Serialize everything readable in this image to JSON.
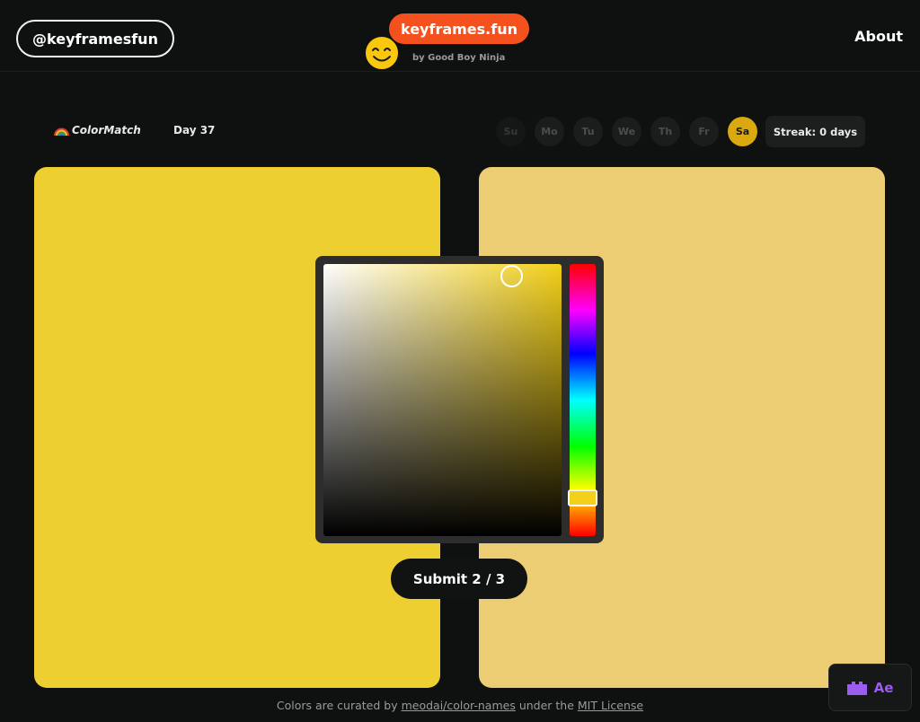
{
  "header": {
    "handle": "@keyframesfun",
    "logo": "keyframes.fun",
    "byline": "by Good Boy Ninja",
    "about": "About"
  },
  "toolbar": {
    "brand": "ColorMatch",
    "brand_icon": "rainbow-icon",
    "day": "Day 37",
    "weekdays": [
      {
        "label": "Su",
        "state": "dim"
      },
      {
        "label": "Mo",
        "state": "inactive"
      },
      {
        "label": "Tu",
        "state": "inactive"
      },
      {
        "label": "We",
        "state": "inactive"
      },
      {
        "label": "Th",
        "state": "inactive"
      },
      {
        "label": "Fr",
        "state": "inactive"
      },
      {
        "label": "Sa",
        "state": "active"
      }
    ],
    "streak": "Streak: 0 days"
  },
  "panels": {
    "target_color": "#eecf31",
    "guess_color": "#eccd73"
  },
  "picker": {
    "hue_color": "#f3d019"
  },
  "submit": {
    "label": "Submit 2 / 3"
  },
  "footer": {
    "prefix": "Colors are curated by ",
    "link1": "meodai/color-names",
    "middle": " under the ",
    "link2": "MIT License"
  },
  "badge": {
    "label": "Ae",
    "icon": "plugin-icon"
  },
  "colors": {
    "accent_orange": "#f4511e",
    "active_day": "#d9a90f",
    "background": "#0f1010",
    "badge_purple": "#9b5cf0"
  }
}
